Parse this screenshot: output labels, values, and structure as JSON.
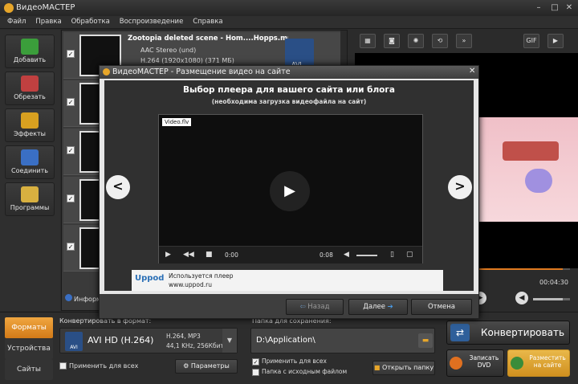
{
  "app": {
    "title": "ВидеоМАСТЕР"
  },
  "menu": [
    "Файл",
    "Правка",
    "Обработка",
    "Воспроизведение",
    "Справка"
  ],
  "sidebar": {
    "items": [
      {
        "label": "Добавить",
        "icon": "add-film-icon",
        "color": "#3b9e3b"
      },
      {
        "label": "Обрезать",
        "icon": "scissors-icon",
        "color": "#c04040"
      },
      {
        "label": "Эффекты",
        "icon": "magic-wand-icon",
        "color": "#d8a020"
      },
      {
        "label": "Соединить",
        "icon": "join-icon",
        "color": "#3a6fc4"
      },
      {
        "label": "Программы",
        "icon": "tickets-icon",
        "color": "#d8b040"
      }
    ]
  },
  "file": {
    "name": "Zootopia deleted scene - Hom....Hopps.mp4",
    "audio": "AAC Stereo (und)",
    "video": "H.264 (1920x1080) (371 МБ)",
    "badge": "AVI",
    "hd": "HD"
  },
  "info_label": "Информ...",
  "preview": {
    "tools": [
      "filter-icon",
      "crop-icon",
      "brightness-icon",
      "rotate-icon",
      "speed-icon",
      "GIF",
      "export-icon"
    ],
    "time_left": "00:04:30",
    "progress": 0.93,
    "volume": 0.8
  },
  "bottom": {
    "tabs": [
      "Форматы",
      "Устройства",
      "Сайты"
    ],
    "active_tab": "Форматы",
    "convert_title": "Конвертировать в формат:",
    "format_name": "AVI HD (H.264)",
    "format_spec1": "H.264, MP3",
    "format_spec2": "44,1 KHz, 256Кбит",
    "format_badge": "AVI",
    "apply_all": "Применить для всех",
    "params_button": "Параметры",
    "save_title": "Папка для сохранения:",
    "save_path": "D:\\Application\\",
    "apply_all2": "Применить для всех",
    "source_folder": "Папка с исходным файлом",
    "open_folder": "Открыть папку",
    "convert_button": "Конвертировать",
    "dvd_button": "Записать DVD",
    "site_button": "Разместить на сайте"
  },
  "dialog": {
    "title": "ВидеоМАСТЕР - Размещение видео на сайте",
    "heading": "Выбор плеера для вашего сайта или блога",
    "subheading": "(необходима загрузка видеофайла на сайт)",
    "file_label": "Video.flv",
    "time_current": "0:00",
    "time_total": "0:08",
    "uses_player": "Используется плеер",
    "player_url": "www.uppod.ru",
    "player_logo": "Uppod",
    "back_button": "Назад",
    "next_button": "Далее",
    "cancel_button": "Отмена"
  },
  "colors": {
    "accent": "#e7a62a",
    "convert": "#2f5f9a",
    "site": "#3a8c3a"
  }
}
